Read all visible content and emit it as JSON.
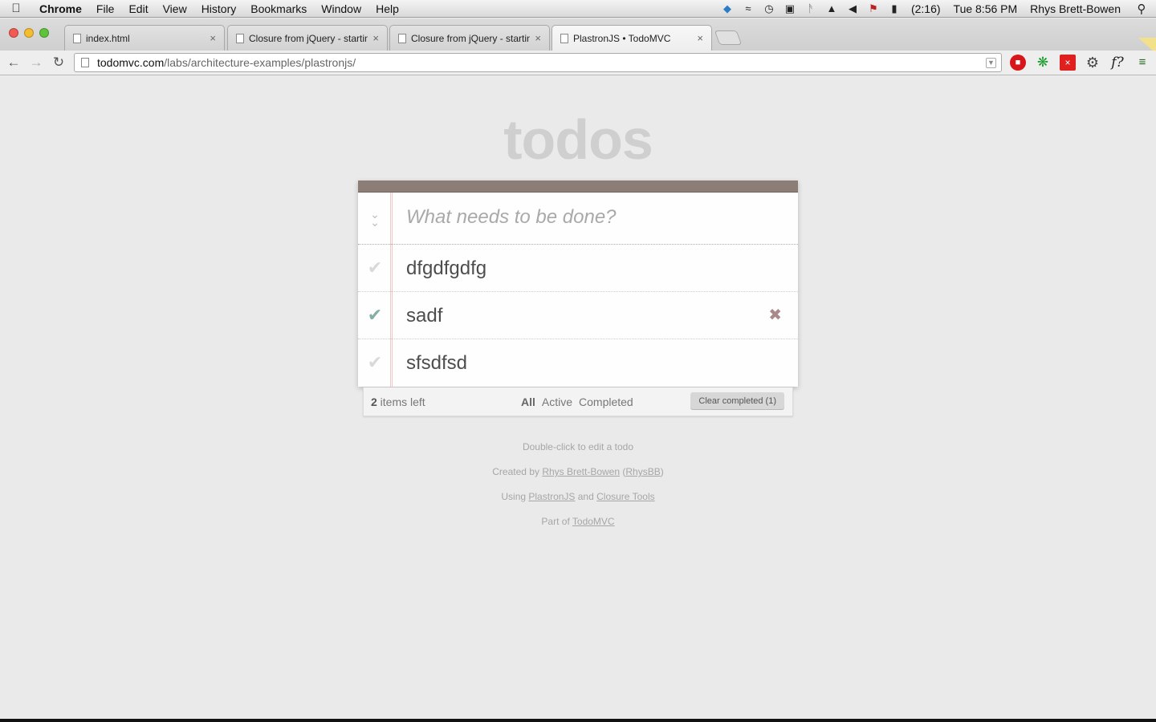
{
  "menubar": {
    "app": "Chrome",
    "menus": [
      "File",
      "Edit",
      "View",
      "History",
      "Bookmarks",
      "Window",
      "Help"
    ],
    "battery": "(2:16)",
    "clock": "Tue 8:56 PM",
    "user": "Rhys Brett-Bowen"
  },
  "tabs": [
    {
      "title": "index.html"
    },
    {
      "title": "Closure from jQuery - startin"
    },
    {
      "title": "Closure from jQuery - startin"
    },
    {
      "title": "PlastronJS • TodoMVC"
    }
  ],
  "omnibox": {
    "host": "todomvc.com",
    "path": "/labs/architecture-examples/plastronjs/"
  },
  "app": {
    "title": "todos",
    "placeholder": "What needs to be done?",
    "todos": [
      {
        "label": "dfgdfgdfg",
        "completed": false
      },
      {
        "label": "sadf",
        "completed": true
      },
      {
        "label": "sfsdfsd",
        "completed": false
      }
    ],
    "count_number": "2",
    "count_text": " items left",
    "filters": {
      "all": "All",
      "active": "Active",
      "completed": "Completed"
    },
    "clear_completed": "Clear completed (1)"
  },
  "info": {
    "edit_hint": "Double-click to edit a todo",
    "created_prefix": "Created by ",
    "created_author": "Rhys Brett-Bowen",
    "created_handle_open": " (",
    "created_handle": "RhysBB",
    "created_handle_close": ")",
    "using_prefix": "Using ",
    "using_lib": "PlastronJS",
    "using_and": " and ",
    "using_tools": "Closure Tools",
    "part_prefix": "Part of ",
    "part_link": "TodoMVC"
  },
  "colors": {
    "header_bar": "#8d7d77",
    "check_done": "#85ada7",
    "title_gray": "#cfcfcf"
  }
}
